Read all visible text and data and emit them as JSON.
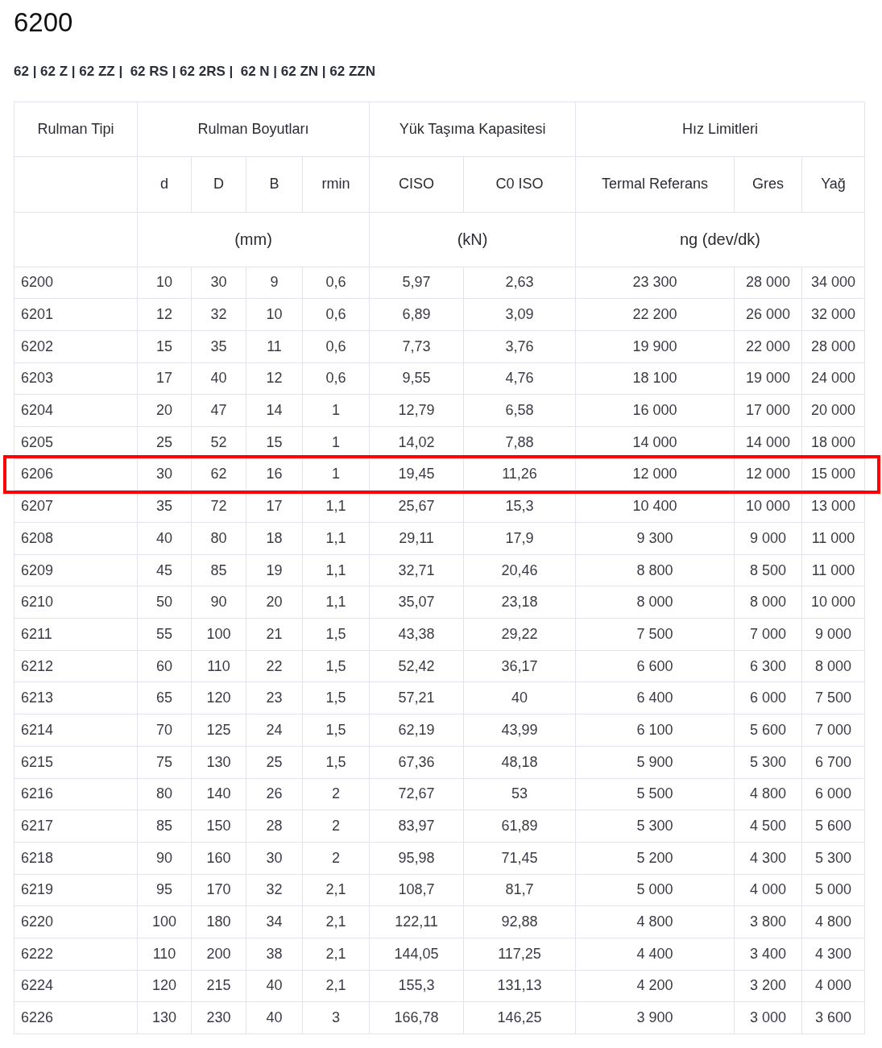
{
  "title": "6200",
  "series": "62 | 62 Z | 62 ZZ |  62 RS | 62 2RS |  62 N | 62 ZN | 62 ZZN",
  "table": {
    "groups": [
      "Rulman Tipi",
      "Rulman Boyutları",
      "Yük Taşıma Kapasitesi",
      "Hız Limitleri"
    ],
    "columns": [
      "",
      "d",
      "D",
      "B",
      "rmin",
      "CISO",
      "C0 ISO",
      "Termal Referans",
      "Gres",
      "Yağ"
    ],
    "units": [
      "(mm)",
      "(kN)",
      "ng (dev/dk)"
    ],
    "rows": [
      {
        "cells": [
          "6200",
          "10",
          "30",
          "9",
          "0,6",
          "5,97",
          "2,63",
          "23 300",
          "28 000",
          "34 000"
        ],
        "highlighted": false
      },
      {
        "cells": [
          "6201",
          "12",
          "32",
          "10",
          "0,6",
          "6,89",
          "3,09",
          "22 200",
          "26 000",
          "32 000"
        ],
        "highlighted": false
      },
      {
        "cells": [
          "6202",
          "15",
          "35",
          "11",
          "0,6",
          "7,73",
          "3,76",
          "19 900",
          "22 000",
          "28 000"
        ],
        "highlighted": false
      },
      {
        "cells": [
          "6203",
          "17",
          "40",
          "12",
          "0,6",
          "9,55",
          "4,76",
          "18 100",
          "19 000",
          "24 000"
        ],
        "highlighted": false
      },
      {
        "cells": [
          "6204",
          "20",
          "47",
          "14",
          "1",
          "12,79",
          "6,58",
          "16 000",
          "17 000",
          "20 000"
        ],
        "highlighted": false
      },
      {
        "cells": [
          "6205",
          "25",
          "52",
          "15",
          "1",
          "14,02",
          "7,88",
          "14 000",
          "14 000",
          "18 000"
        ],
        "highlighted": false
      },
      {
        "cells": [
          "6206",
          "30",
          "62",
          "16",
          "1",
          "19,45",
          "11,26",
          "12 000",
          "12 000",
          "15 000"
        ],
        "highlighted": true
      },
      {
        "cells": [
          "6207",
          "35",
          "72",
          "17",
          "1,1",
          "25,67",
          "15,3",
          "10 400",
          "10 000",
          "13 000"
        ],
        "highlighted": false
      },
      {
        "cells": [
          "6208",
          "40",
          "80",
          "18",
          "1,1",
          "29,11",
          "17,9",
          "9 300",
          "9 000",
          "11 000"
        ],
        "highlighted": false
      },
      {
        "cells": [
          "6209",
          "45",
          "85",
          "19",
          "1,1",
          "32,71",
          "20,46",
          "8 800",
          "8 500",
          "11 000"
        ],
        "highlighted": false
      },
      {
        "cells": [
          "6210",
          "50",
          "90",
          "20",
          "1,1",
          "35,07",
          "23,18",
          "8 000",
          "8 000",
          "10 000"
        ],
        "highlighted": false
      },
      {
        "cells": [
          "6211",
          "55",
          "100",
          "21",
          "1,5",
          "43,38",
          "29,22",
          "7 500",
          "7 000",
          "9 000"
        ],
        "highlighted": false
      },
      {
        "cells": [
          "6212",
          "60",
          "110",
          "22",
          "1,5",
          "52,42",
          "36,17",
          "6 600",
          "6 300",
          "8 000"
        ],
        "highlighted": false
      },
      {
        "cells": [
          "6213",
          "65",
          "120",
          "23",
          "1,5",
          "57,21",
          "40",
          "6 400",
          "6 000",
          "7 500"
        ],
        "highlighted": false
      },
      {
        "cells": [
          "6214",
          "70",
          "125",
          "24",
          "1,5",
          "62,19",
          "43,99",
          "6 100",
          "5 600",
          "7 000"
        ],
        "highlighted": false
      },
      {
        "cells": [
          "6215",
          "75",
          "130",
          "25",
          "1,5",
          "67,36",
          "48,18",
          "5 900",
          "5 300",
          "6 700"
        ],
        "highlighted": false
      },
      {
        "cells": [
          "6216",
          "80",
          "140",
          "26",
          "2",
          "72,67",
          "53",
          "5 500",
          "4 800",
          "6 000"
        ],
        "highlighted": false
      },
      {
        "cells": [
          "6217",
          "85",
          "150",
          "28",
          "2",
          "83,97",
          "61,89",
          "5 300",
          "4 500",
          "5 600"
        ],
        "highlighted": false
      },
      {
        "cells": [
          "6218",
          "90",
          "160",
          "30",
          "2",
          "95,98",
          "71,45",
          "5 200",
          "4 300",
          "5 300"
        ],
        "highlighted": false
      },
      {
        "cells": [
          "6219",
          "95",
          "170",
          "32",
          "2,1",
          "108,7",
          "81,7",
          "5 000",
          "4 000",
          "5 000"
        ],
        "highlighted": false
      },
      {
        "cells": [
          "6220",
          "100",
          "180",
          "34",
          "2,1",
          "122,11",
          "92,88",
          "4 800",
          "3 800",
          "4 800"
        ],
        "highlighted": false
      },
      {
        "cells": [
          "6222",
          "110",
          "200",
          "38",
          "2,1",
          "144,05",
          "117,25",
          "4 400",
          "3 400",
          "4 300"
        ],
        "highlighted": false
      },
      {
        "cells": [
          "6224",
          "120",
          "215",
          "40",
          "2,1",
          "155,3",
          "131,13",
          "4 200",
          "3 200",
          "4 000"
        ],
        "highlighted": false
      },
      {
        "cells": [
          "6226",
          "130",
          "230",
          "40",
          "3",
          "166,78",
          "146,25",
          "3 900",
          "3 000",
          "3 600"
        ],
        "highlighted": false
      }
    ]
  }
}
